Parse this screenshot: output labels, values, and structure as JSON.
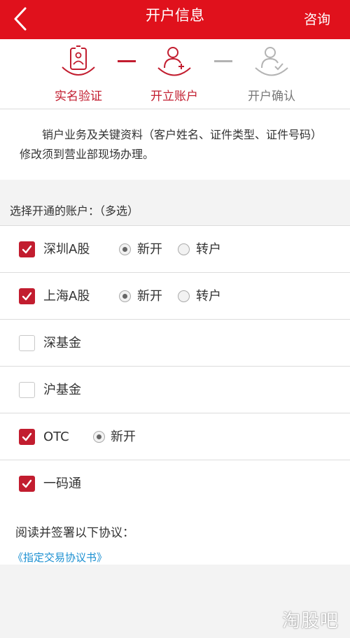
{
  "header": {
    "title": "开户信息",
    "action_label": "咨询",
    "background_color": "#e0111c"
  },
  "steps": [
    {
      "label": "实名验证",
      "state": "active",
      "icon": "id-card-icon"
    },
    {
      "label": "开立账户",
      "state": "active",
      "icon": "user-add-icon"
    },
    {
      "label": "开户确认",
      "state": "inactive",
      "icon": "user-check-icon"
    }
  ],
  "notice": {
    "text": "销户业务及关键资料（客户姓名、证件类型、证件号码）修改须到营业部现场办理。"
  },
  "accounts": {
    "section_title": "选择开通的账户：（多选）",
    "items": [
      {
        "label": "深圳A股",
        "checked": true,
        "options": [
          {
            "label": "新开",
            "selected": true
          },
          {
            "label": "转户",
            "selected": false
          }
        ]
      },
      {
        "label": "上海A股",
        "checked": true,
        "options": [
          {
            "label": "新开",
            "selected": true
          },
          {
            "label": "转户",
            "selected": false
          }
        ]
      },
      {
        "label": "深基金",
        "checked": false,
        "options": []
      },
      {
        "label": "沪基金",
        "checked": false,
        "options": []
      },
      {
        "label": "OTC",
        "checked": true,
        "options": [
          {
            "label": "新开",
            "selected": true
          }
        ]
      },
      {
        "label": "一码通",
        "checked": true,
        "options": []
      }
    ]
  },
  "agreement": {
    "prompt": "阅读并签署以下协议：",
    "link": "《指定交易协议书》"
  },
  "watermark": "淘股吧",
  "colors": {
    "accent": "#c21d2f",
    "link": "#1a8fd1",
    "inactive": "#b3b3b3"
  }
}
